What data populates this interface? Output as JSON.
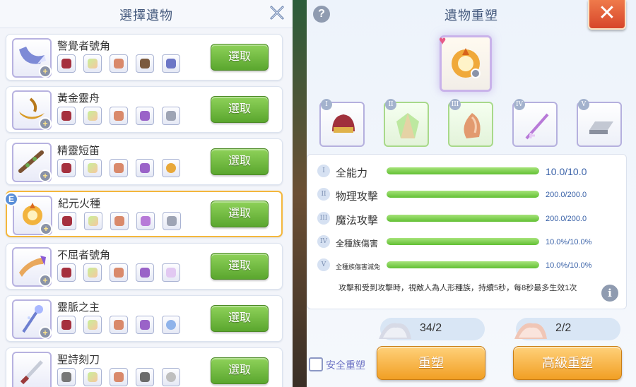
{
  "left_panel": {
    "title": "選擇遺物",
    "close_icon": "close-x-icon",
    "select_label": "選取",
    "selected_badge": "E",
    "items": [
      {
        "name": "警覺者號角",
        "icon": "horn-icon",
        "selected": false
      },
      {
        "name": "黃金靈舟",
        "icon": "golden-boat-icon",
        "selected": false
      },
      {
        "name": "精靈短笛",
        "icon": "flute-icon",
        "selected": false
      },
      {
        "name": "紀元火種",
        "icon": "fire-seed-icon",
        "selected": true
      },
      {
        "name": "不屈者號角",
        "icon": "horn-icon",
        "selected": false
      },
      {
        "name": "靈脈之主",
        "icon": "staff-icon",
        "selected": false
      },
      {
        "name": "聖詩刻刀",
        "icon": "knife-icon",
        "selected": false
      }
    ]
  },
  "right_panel": {
    "title": "遺物重塑",
    "help_icon": "?",
    "close_icon": "✕",
    "tiers": [
      "I",
      "II",
      "III",
      "IV",
      "V"
    ],
    "stats": [
      {
        "num": "I",
        "name": "全能力",
        "value": "10.0/10.0",
        "fill": 1.0
      },
      {
        "num": "II",
        "name": "物理攻擊",
        "value": "200.0/200.0",
        "fill": 1.0
      },
      {
        "num": "III",
        "name": "魔法攻擊",
        "value": "200.0/200.0",
        "fill": 1.0
      },
      {
        "num": "IV",
        "name": "全種族傷害",
        "value": "10.0%/10.0%",
        "fill": 1.0
      },
      {
        "num": "V",
        "name": "全種族傷害減免",
        "value": "10.0%/10.0%",
        "fill": 1.0
      }
    ],
    "description": "攻擊和受到攻擊時，視敵人為人形種族，持續5秒，每8秒最多生效1次",
    "info_icon": "i",
    "costs": [
      "34/2",
      "2/2"
    ],
    "safe_label": "安全重塑",
    "reforge_label": "重塑",
    "advanced_label": "高級重塑"
  }
}
